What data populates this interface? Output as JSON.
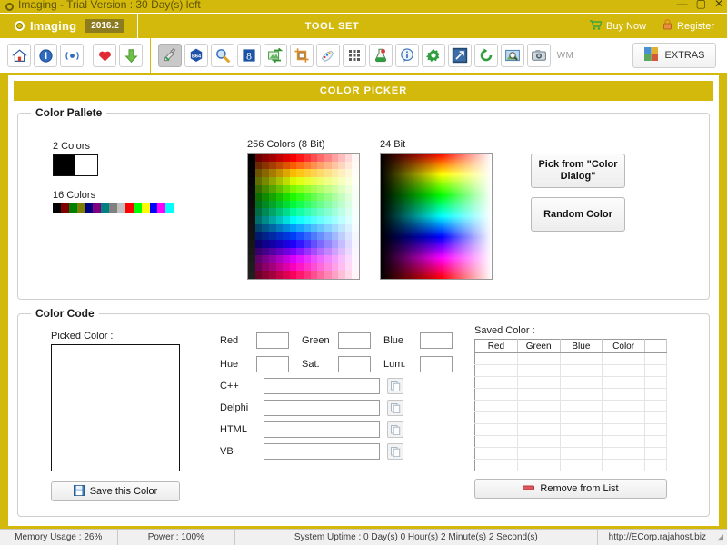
{
  "window": {
    "title": "Imaging - Trial Version : 30 Day(s) left",
    "minimize": "—",
    "maximize": "▢",
    "close": "✕",
    "accent_color": "#d4b90d"
  },
  "header": {
    "brand": "Imaging",
    "version": "2016.2",
    "toolset_label": "TOOL SET",
    "links": [
      {
        "label": "Buy Now",
        "icon": "cart-icon"
      },
      {
        "label": "Register",
        "icon": "lock-icon"
      }
    ]
  },
  "toolbar": {
    "nav_buttons": [
      {
        "name": "home-icon",
        "title": "Home"
      },
      {
        "name": "info-icon",
        "title": "Info"
      },
      {
        "name": "update-icon",
        "title": "Update"
      }
    ],
    "fav_buttons": [
      {
        "name": "heart-icon",
        "title": "Favorite"
      },
      {
        "name": "download-icon",
        "title": "Download"
      }
    ],
    "tool_buttons": [
      {
        "name": "color-picker-icon",
        "title": "Color Picker",
        "active": true
      },
      {
        "name": "base64-icon",
        "title": "Base64",
        "label": "B64"
      },
      {
        "name": "magnifier-icon",
        "title": "Magnifier"
      },
      {
        "name": "google-icon",
        "title": "Google Image",
        "label": "8"
      },
      {
        "name": "image-convert-icon",
        "title": "Convert"
      },
      {
        "name": "crop-icon",
        "title": "Crop"
      },
      {
        "name": "paint-icon",
        "title": "Paint"
      },
      {
        "name": "grid-icon",
        "title": "Grid"
      },
      {
        "name": "flask-icon",
        "title": "Effects"
      },
      {
        "name": "info-bubble-icon",
        "title": "Image Info"
      },
      {
        "name": "gear-icon",
        "title": "Settings"
      },
      {
        "name": "resize-icon",
        "title": "Resize"
      },
      {
        "name": "rotate-icon",
        "title": "Rotate"
      },
      {
        "name": "photo-search-icon",
        "title": "Photo Search"
      },
      {
        "name": "camera-icon",
        "title": "Camera"
      },
      {
        "name": "watermark-icon",
        "title": "Watermark",
        "label": "WM"
      }
    ],
    "extras_label": "EXTRAS"
  },
  "page": {
    "banner_title": "COLOR PICKER"
  },
  "color_pallete": {
    "legend": "Color Pallete",
    "two_colors_label": "2 Colors",
    "two_colors": [
      "#000000",
      "#ffffff"
    ],
    "sixteen_colors_label": "16 Colors",
    "sixteen_colors": [
      "#000000",
      "#800000",
      "#008000",
      "#808000",
      "#000080",
      "#800080",
      "#008080",
      "#808080",
      "#c0c0c0",
      "#ff0000",
      "#00ff00",
      "#ffff00",
      "#0000ff",
      "#ff00ff",
      "#00ffff",
      "#ffffff"
    ],
    "p256_label": "256 Colors (8 Bit)",
    "p24_label": "24 Bit",
    "pick_dialog_button": "Pick from \"Color Dialog\"",
    "random_color_button": "Random Color"
  },
  "color_code": {
    "legend": "Color Code",
    "picked_color_label": "Picked Color :",
    "picked_color_value": "#ffffff",
    "save_button": "Save this Color",
    "channels": [
      {
        "label": "Red",
        "value": "",
        "name": "red-field"
      },
      {
        "label": "Green",
        "value": "",
        "name": "green-field"
      },
      {
        "label": "Blue",
        "value": "",
        "name": "blue-field"
      },
      {
        "label": "Hue",
        "value": "",
        "name": "hue-field"
      },
      {
        "label": "Sat.",
        "value": "",
        "name": "sat-field"
      },
      {
        "label": "Lum.",
        "value": "",
        "name": "lum-field"
      }
    ],
    "codes": [
      {
        "label": "C++",
        "value": "",
        "name": "cpp-code-field"
      },
      {
        "label": "Delphi",
        "value": "",
        "name": "delphi-code-field"
      },
      {
        "label": "HTML",
        "value": "",
        "name": "html-code-field"
      },
      {
        "label": "VB",
        "value": "",
        "name": "vb-code-field"
      }
    ],
    "copy_icon": "copy-icon"
  },
  "saved_color": {
    "label": "Saved Color :",
    "columns": [
      "Red",
      "Green",
      "Blue",
      "Color"
    ],
    "rows": [],
    "remove_button": "Remove from List"
  },
  "statusbar": {
    "memory": "Memory Usage : 26%",
    "power": "Power : 100%",
    "uptime": "System Uptime : 0 Day(s) 0 Hour(s) 2 Minute(s) 2 Second(s)",
    "website": "http://ECorp.rajahost.biz"
  }
}
